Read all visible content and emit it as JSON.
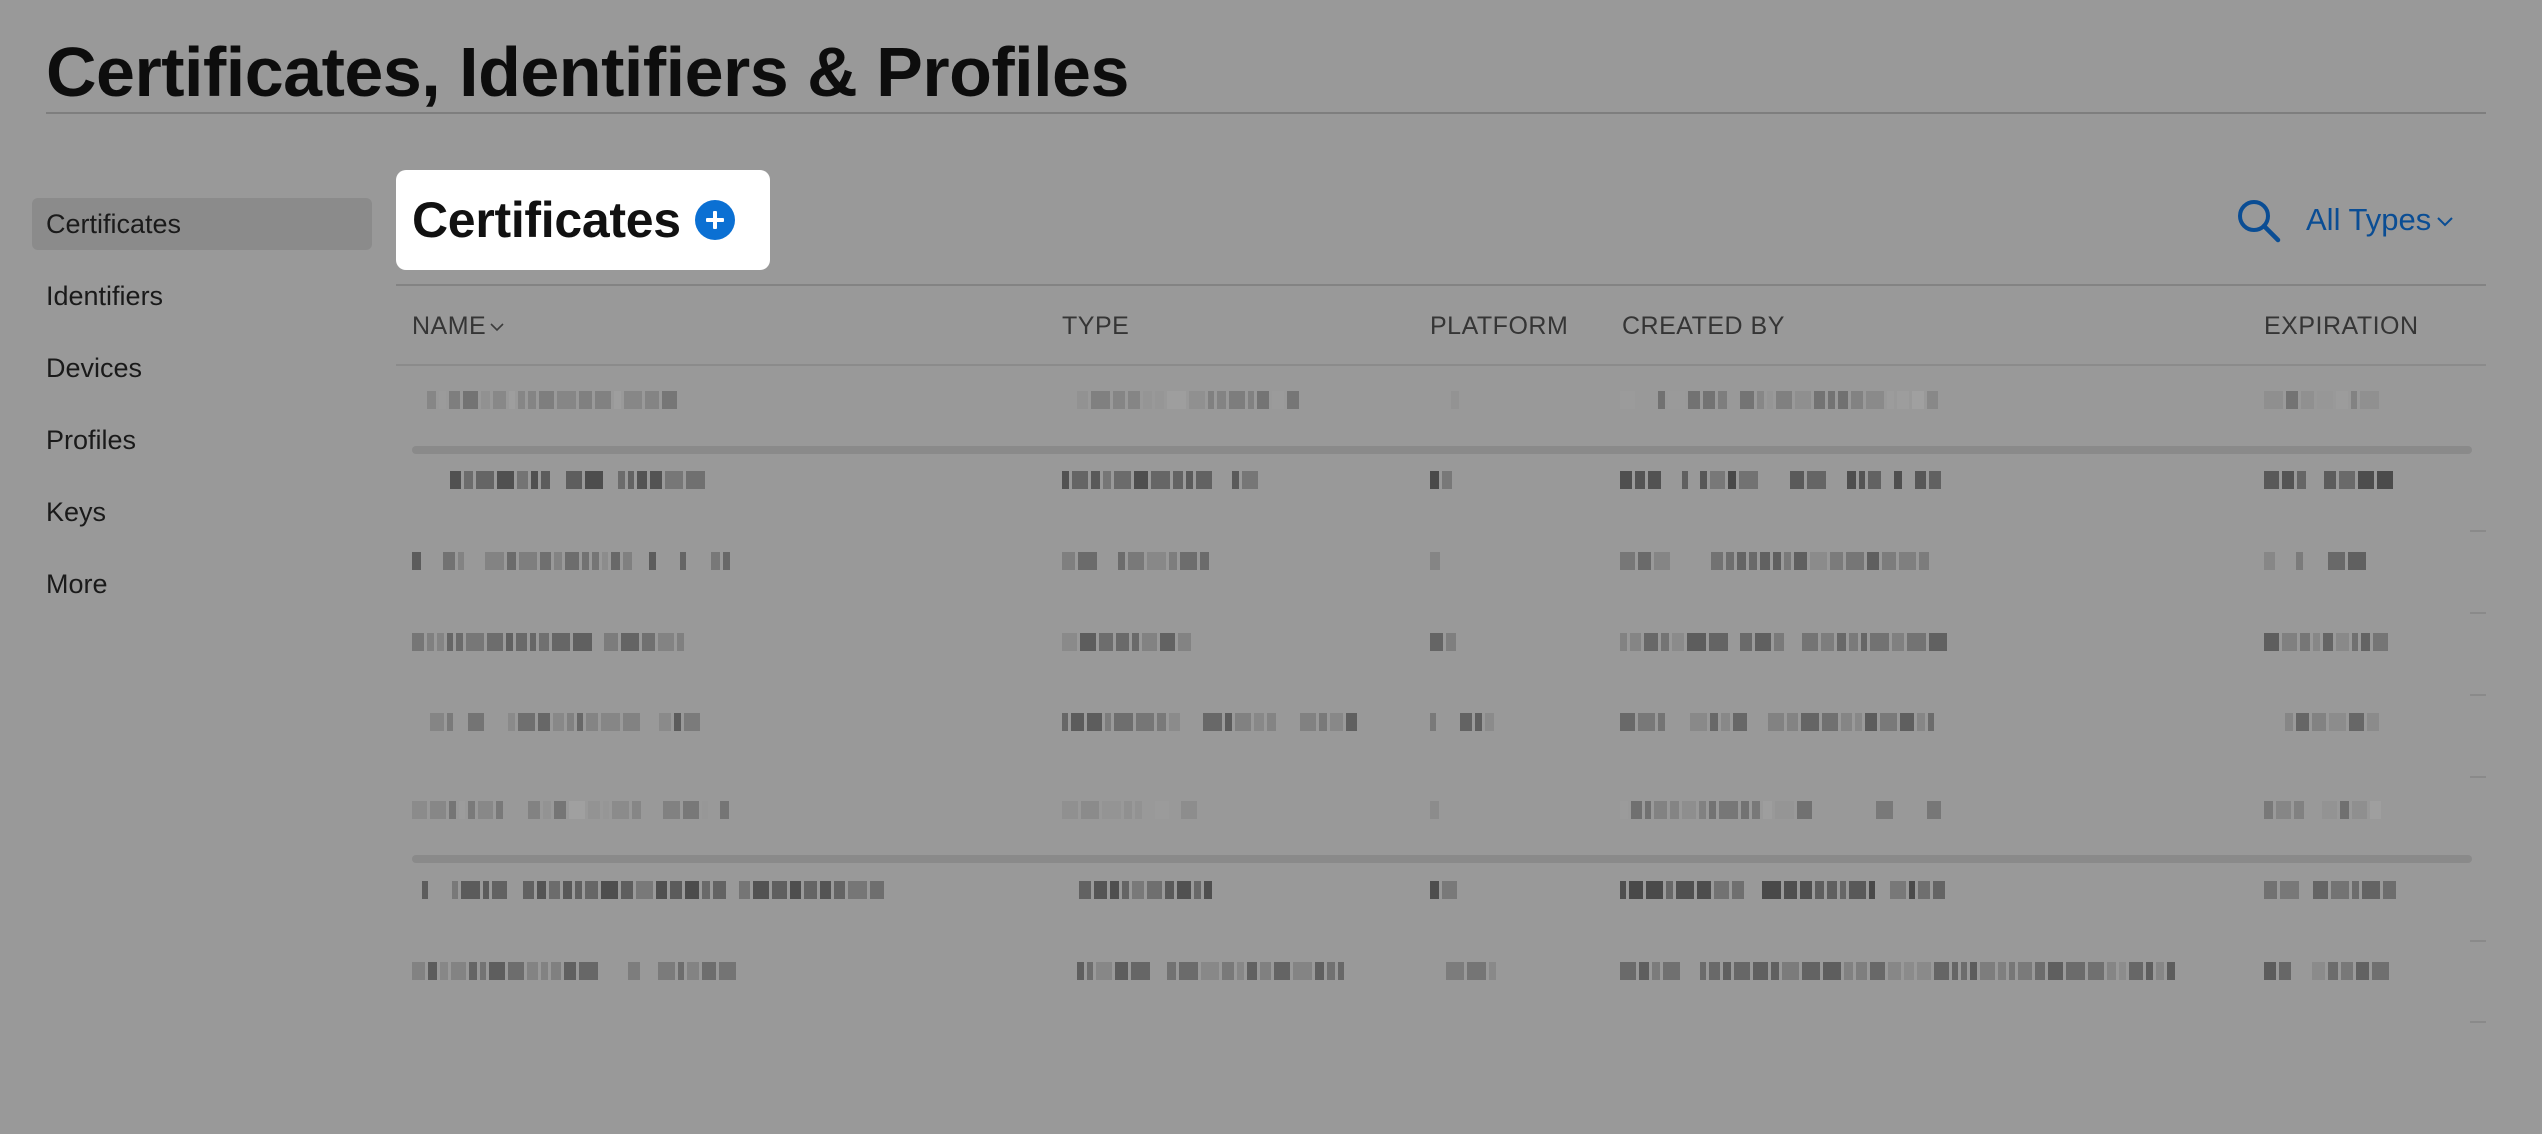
{
  "page": {
    "title": "Certificates, Identifiers & Profiles"
  },
  "sidebar": {
    "items": [
      {
        "label": "Certificates",
        "active": true
      },
      {
        "label": "Identifiers",
        "active": false
      },
      {
        "label": "Devices",
        "active": false
      },
      {
        "label": "Profiles",
        "active": false
      },
      {
        "label": "Keys",
        "active": false
      },
      {
        "label": "More",
        "active": false
      }
    ]
  },
  "section": {
    "title": "Certificates",
    "add_icon": "plus-circle-icon",
    "search_icon": "search-icon",
    "filter_label": "All Types",
    "filter_icon": "chevron-down-icon"
  },
  "table": {
    "columns": [
      "NAME",
      "TYPE",
      "PLATFORM",
      "CREATED BY",
      "EXPIRATION"
    ],
    "sort_column": "NAME",
    "rows_redacted": 8
  },
  "colors": {
    "overlay_background": "#999999",
    "accent_blue": "#0b70d3",
    "link_blue": "#0a4d94",
    "highlight_white": "#ffffff"
  }
}
